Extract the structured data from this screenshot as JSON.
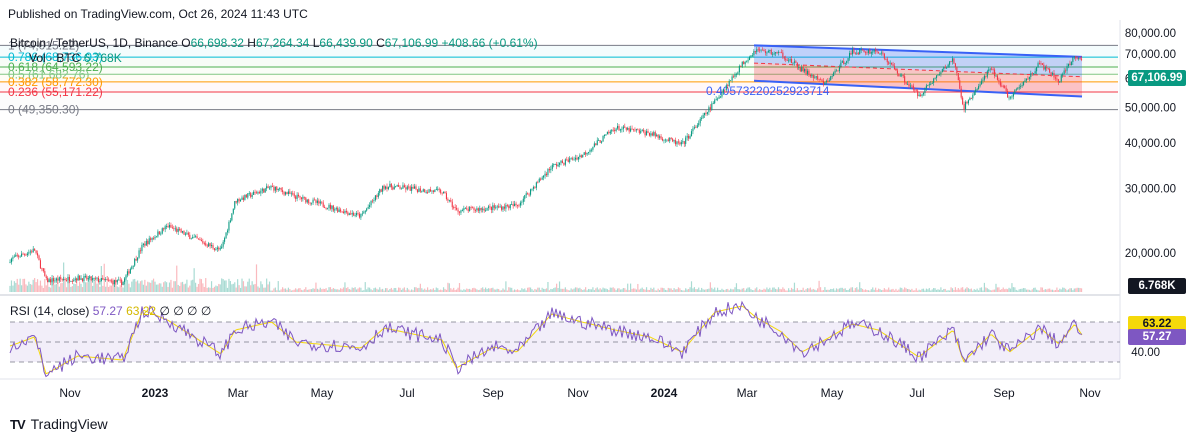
{
  "header": {
    "published": "Published on TradingView.com, Oct 26, 2024 11:43 UTC"
  },
  "legend": {
    "symbol": "Bitcoin / TetherUS, 1D, Binance",
    "open_label": "O",
    "open": "66,698.32",
    "high_label": "H",
    "high": "67,264.34",
    "low_label": "L",
    "low": "66,439.90",
    "close_label": "C",
    "close": "67,106.99",
    "change": "+408.66 (+0.61%)",
    "vol_label": "Vol · BTC",
    "vol_value": "6.768K",
    "rsi_label": "RSI (14, close)",
    "rsi_value": "57.27",
    "rsi_ma_value": "63.22",
    "rsi_placeholders": "∅ ∅ ∅ ∅"
  },
  "fib_levels": [
    {
      "label": "1 (74,015.22)",
      "price": 74015.22,
      "color": "#787b86"
    },
    {
      "label": "0.786 (68,736.93)",
      "price": 68736.93,
      "color": "#00bcd4"
    },
    {
      "label": "0.618 (64,593.22)",
      "price": 64593.22,
      "color": "#4caf50"
    },
    {
      "label": "0.5 (61,682.76)",
      "price": 61682.76,
      "color": "#81c784"
    },
    {
      "label": "0.382 (58,772.30)",
      "price": 58772.3,
      "color": "#ff9800"
    },
    {
      "label": "0.236 (55,171.22)",
      "price": 55171.22,
      "color": "#f23645"
    },
    {
      "label": "0 (49,350.30)",
      "price": 49350.3,
      "color": "#787b86"
    }
  ],
  "channel_annotation": "0.40573220252923714",
  "price_axis_ticks": [
    "80,000.00",
    "70,000.00",
    "60,000.00",
    "50,000.00",
    "40,000.00",
    "30,000.00",
    "20,000.00"
  ],
  "price_tags": {
    "last_price": "67,106.99",
    "volume": "6.768K",
    "rsi_ma": "63.22",
    "rsi": "57.27"
  },
  "rsi_axis_ticks": [
    "60.00",
    "40.00"
  ],
  "time_axis": [
    "Nov",
    "2023",
    "Mar",
    "May",
    "Jul",
    "Sep",
    "Nov",
    "2024",
    "Mar",
    "May",
    "Jul",
    "Sep",
    "Nov"
  ],
  "footer": {
    "brand": "TradingView",
    "logo_mark": "TV"
  },
  "colors": {
    "up": "#089981",
    "down": "#f23645",
    "channel": "#3861f6",
    "rsi": "#7e57c2",
    "rsi_ma": "#f5d90a",
    "last_price_tag": "#089981",
    "volume_tag": "#131722"
  },
  "chart_data": {
    "type": "candlestick",
    "title": "Bitcoin / TetherUS, 1D, Binance",
    "y_scale": "log",
    "ylim": [
      16000,
      82000
    ],
    "x_axis_labels": [
      "Nov",
      "2023",
      "Mar",
      "May",
      "Jul",
      "Sep",
      "Nov",
      "2024",
      "Mar",
      "May",
      "Jul",
      "Sep",
      "Nov"
    ],
    "price_series": {
      "name": "BTCUSDT",
      "dates": [
        "2022-10-15",
        "2022-11-01",
        "2022-11-09",
        "2022-12-01",
        "2023-01-01",
        "2023-01-15",
        "2023-02-01",
        "2023-03-10",
        "2023-03-20",
        "2023-04-14",
        "2023-05-01",
        "2023-06-15",
        "2023-07-01",
        "2023-08-10",
        "2023-08-20",
        "2023-09-15",
        "2023-10-01",
        "2023-10-25",
        "2023-11-15",
        "2023-12-08",
        "2024-01-01",
        "2024-01-23",
        "2024-02-15",
        "2024-03-05",
        "2024-03-14",
        "2024-04-01",
        "2024-04-15",
        "2024-05-01",
        "2024-05-20",
        "2024-06-07",
        "2024-07-05",
        "2024-07-29",
        "2024-08-05",
        "2024-08-24",
        "2024-09-06",
        "2024-09-27",
        "2024-10-10",
        "2024-10-21",
        "2024-10-26"
      ],
      "close": [
        19200,
        20400,
        16800,
        17100,
        16600,
        21000,
        23700,
        20300,
        27800,
        30300,
        28500,
        25200,
        30500,
        29400,
        26100,
        26600,
        27000,
        34500,
        37000,
        44000,
        42500,
        39500,
        52000,
        66000,
        72000,
        70000,
        63500,
        58000,
        71000,
        71400,
        54000,
        68000,
        50000,
        64000,
        53000,
        66000,
        59000,
        69000,
        67107
      ]
    },
    "fib_retracement": {
      "1": 74015.22,
      "0.786": 68736.93,
      "0.618": 64593.22,
      "0.5": 61682.76,
      "0.382": 58772.3,
      "0.236": 55171.22,
      "0": 49350.3
    },
    "channel": {
      "annotation": "0.40573220252923714",
      "start": "2024-03-13",
      "end": "2024-10-26",
      "upper": [
        74000,
        68800
      ],
      "lower": [
        59200,
        53600
      ]
    },
    "volume": {
      "last": "6.768K",
      "unit": "BTC"
    },
    "rsi": {
      "period": 14,
      "source": "close",
      "last": 57.27,
      "ma_last": 63.22,
      "band_upper": 70,
      "band_middle": 50,
      "band_lower": 30,
      "ticks": [
        60,
        40
      ],
      "values": [
        46,
        55,
        18,
        36,
        32,
        82,
        72,
        38,
        62,
        70,
        50,
        44,
        64,
        52,
        24,
        45,
        40,
        78,
        70,
        62,
        55,
        40,
        80,
        86,
        75,
        60,
        40,
        52,
        68,
        62,
        35,
        62,
        30,
        58,
        40,
        64,
        48,
        68,
        57
      ]
    }
  }
}
